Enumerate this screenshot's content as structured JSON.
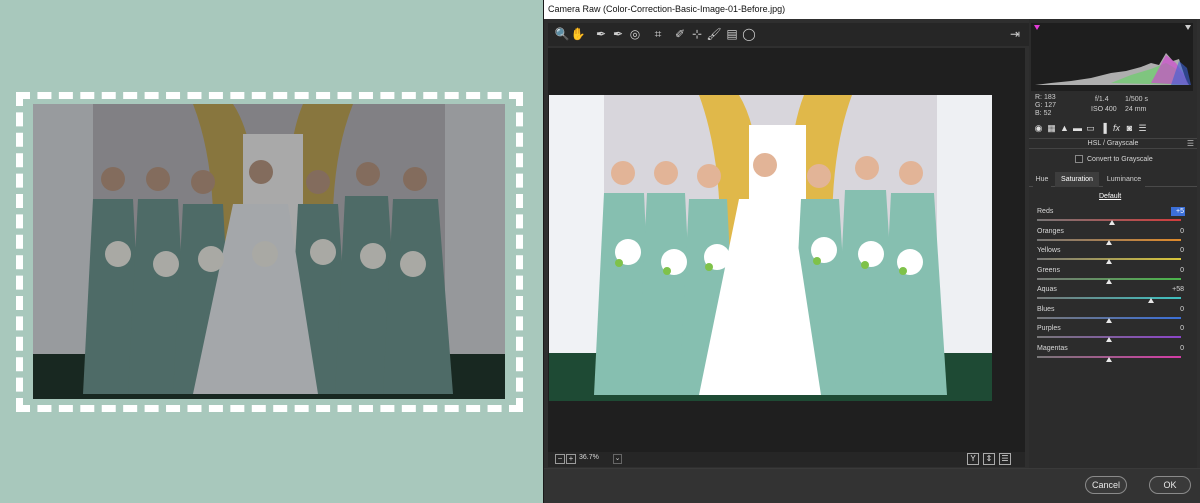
{
  "window": {
    "title": "Camera Raw (Color-Correction-Basic-Image-01-Before.jpg)"
  },
  "toolbar": {
    "tools": [
      {
        "name": "zoom-tool-icon",
        "glyph": "🔍"
      },
      {
        "name": "hand-tool-icon",
        "glyph": "✋"
      },
      {
        "name": "white-balance-tool-icon",
        "glyph": "✒"
      },
      {
        "name": "color-sampler-tool-icon",
        "glyph": "✒"
      },
      {
        "name": "targeted-adjustment-tool-icon",
        "glyph": "◎"
      },
      {
        "name": "crop-tool-icon",
        "glyph": "⌗"
      },
      {
        "name": "spot-removal-tool-icon",
        "glyph": "✐"
      },
      {
        "name": "red-eye-removal-tool-icon",
        "glyph": "⊹"
      },
      {
        "name": "adjustment-brush-tool-icon",
        "glyph": "🖌"
      },
      {
        "name": "graduated-filter-tool-icon",
        "glyph": "▤"
      },
      {
        "name": "radial-filter-tool-icon",
        "glyph": "◯"
      }
    ],
    "export_icon": "⇥"
  },
  "statusbar": {
    "zoom_out": "−",
    "zoom_in": "+",
    "zoom_level": "36.7%",
    "zoom_dropdown": "⌄",
    "right_buttons": [
      "Y",
      "⇕",
      "☰"
    ]
  },
  "readout": {
    "r_label": "R:",
    "r_value": "183",
    "g_label": "G:",
    "g_value": "127",
    "b_label": "B:",
    "b_value": "52",
    "aperture": "f/1.4",
    "shutter": "1/500 s",
    "iso": "ISO 400",
    "focal": "24 mm"
  },
  "panel_tabs": [
    "◉",
    "▦",
    "▲",
    "▬",
    "▭",
    "▐",
    "fx",
    "◙",
    "☰"
  ],
  "section": {
    "title": "HSL / Grayscale",
    "menu_glyph": "☰"
  },
  "grayscale": {
    "label": "Convert to Grayscale",
    "checked": false
  },
  "hsl_tabs": [
    {
      "label": "Hue",
      "active": false
    },
    {
      "label": "Saturation",
      "active": true
    },
    {
      "label": "Luminance",
      "active": false
    }
  ],
  "default_link": "Default",
  "sliders": [
    {
      "label": "Reds",
      "value": "+5",
      "fraction": 0.52,
      "editing": true,
      "color": "#d23c3c"
    },
    {
      "label": "Oranges",
      "value": "0",
      "fraction": 0.5,
      "editing": false,
      "color": "#e08a2a"
    },
    {
      "label": "Yellows",
      "value": "0",
      "fraction": 0.5,
      "editing": false,
      "color": "#d9c63a"
    },
    {
      "label": "Greens",
      "value": "0",
      "fraction": 0.5,
      "editing": false,
      "color": "#4ab54a"
    },
    {
      "label": "Aquas",
      "value": "+58",
      "fraction": 0.79,
      "editing": false,
      "color": "#3ec1c1"
    },
    {
      "label": "Blues",
      "value": "0",
      "fraction": 0.5,
      "editing": false,
      "color": "#3b6fd8"
    },
    {
      "label": "Purples",
      "value": "0",
      "fraction": 0.5,
      "editing": false,
      "color": "#8b45c9"
    },
    {
      "label": "Magentas",
      "value": "0",
      "fraction": 0.5,
      "editing": false,
      "color": "#d43ca6"
    }
  ],
  "buttons": {
    "cancel": "Cancel",
    "ok": "OK"
  }
}
